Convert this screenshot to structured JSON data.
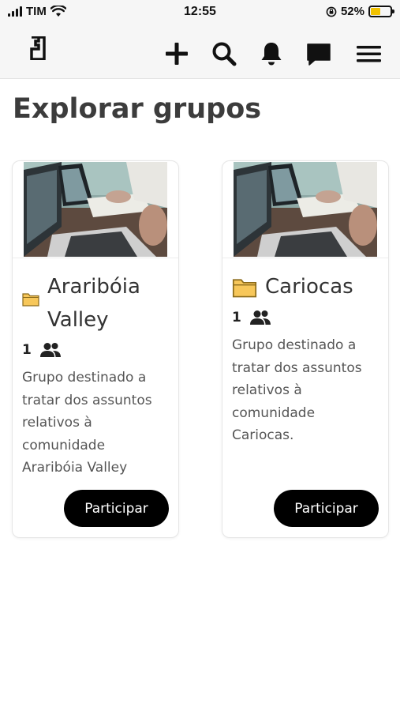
{
  "status_bar": {
    "carrier": "TIM",
    "time": "12:55",
    "battery_percent": "52%",
    "battery_level": 0.52,
    "battery_color": "#f2c200"
  },
  "header": {
    "icons": [
      "brand-logo",
      "plus-icon",
      "search-icon",
      "bell-icon",
      "chat-icon",
      "menu-icon"
    ]
  },
  "page": {
    "title": "Explorar grupos"
  },
  "groups": [
    {
      "name": "Araribóia Valley",
      "name_lines": [
        "Araribóia",
        "Valley"
      ],
      "member_count": "1",
      "description_lines": [
        "Grupo destinado a",
        "tratar dos assuntos",
        "relativos à",
        "comunidade",
        "Araribóia Valley"
      ],
      "button_label": "Participar",
      "folder_color": "#f7c75a"
    },
    {
      "name": "Cariocas",
      "member_count": "1",
      "description_lines": [
        "Grupo destinado a",
        "tratar dos assuntos",
        "relativos à",
        "comunidade",
        "Cariocas."
      ],
      "button_label": "Participar",
      "folder_color": "#f7c75a"
    }
  ]
}
